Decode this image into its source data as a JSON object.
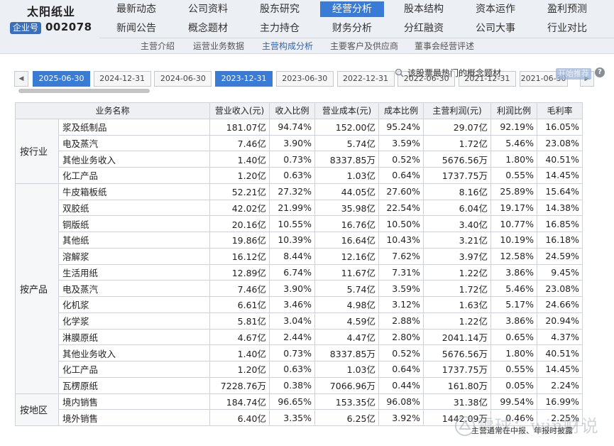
{
  "company": {
    "name": "太阳纸业",
    "code_label": "企业号",
    "code": "002078"
  },
  "nav": {
    "row1": [
      "最新动态",
      "公司资料",
      "股东研究",
      "经营分析",
      "股本结构",
      "资本运作",
      "盈利预测"
    ],
    "row2": [
      "新闻公告",
      "概念题材",
      "主力持仓",
      "财务分析",
      "分红融资",
      "公司大事",
      "行业对比"
    ],
    "active": "经营分析"
  },
  "subnav": {
    "items": [
      "主营介绍",
      "运营业务数据",
      "主营构成分析",
      "主要客户及供应商",
      "董事会经营评述"
    ],
    "active": "主营构成分析"
  },
  "periods": {
    "dates": [
      "2025-06-30",
      "2024-12-31",
      "2024-06-30",
      "2023-12-31",
      "2023-06-30",
      "2022-12-31",
      "2022-06-30",
      "2021-12-31",
      "2021-06-30"
    ],
    "active_indices": [
      0,
      3
    ],
    "prev_arrow": "◀",
    "next_arrow": "▶"
  },
  "concept": {
    "link_text": "该股票最热门的概念题材",
    "faded_button": "开始推荐",
    "help": "?"
  },
  "table": {
    "headers": [
      "业务名称",
      "营业收入(元)",
      "收入比例",
      "营业成本(元)",
      "成本比例",
      "主营利润(元)",
      "利润比例",
      "毛利率"
    ],
    "groups": [
      {
        "category": "按行业",
        "rows": [
          [
            "浆及纸制品",
            "181.07亿",
            "94.74%",
            "152.00亿",
            "95.24%",
            "29.07亿",
            "92.19%",
            "16.05%"
          ],
          [
            "电及蒸汽",
            "7.46亿",
            "3.90%",
            "5.74亿",
            "3.59%",
            "1.72亿",
            "5.46%",
            "23.08%"
          ],
          [
            "其他业务收入",
            "1.40亿",
            "0.73%",
            "8337.85万",
            "0.52%",
            "5676.56万",
            "1.80%",
            "40.51%"
          ],
          [
            "化工产品",
            "1.20亿",
            "0.63%",
            "1.03亿",
            "0.64%",
            "1737.75万",
            "0.55%",
            "14.45%"
          ]
        ]
      },
      {
        "category": "按产品",
        "rows": [
          [
            "牛皮箱板纸",
            "52.21亿",
            "27.32%",
            "44.05亿",
            "27.60%",
            "8.16亿",
            "25.89%",
            "15.64%"
          ],
          [
            "双胶纸",
            "42.02亿",
            "21.99%",
            "35.98亿",
            "22.54%",
            "6.04亿",
            "19.17%",
            "14.38%"
          ],
          [
            "铜版纸",
            "20.16亿",
            "10.55%",
            "16.76亿",
            "10.50%",
            "3.40亿",
            "10.77%",
            "16.85%"
          ],
          [
            "其他纸",
            "19.86亿",
            "10.39%",
            "16.64亿",
            "10.43%",
            "3.21亿",
            "10.19%",
            "16.18%"
          ],
          [
            "溶解浆",
            "16.12亿",
            "8.44%",
            "12.16亿",
            "7.62%",
            "3.97亿",
            "12.58%",
            "24.59%"
          ],
          [
            "生活用纸",
            "12.89亿",
            "6.74%",
            "11.67亿",
            "7.31%",
            "1.22亿",
            "3.86%",
            "9.45%"
          ],
          [
            "电及蒸汽",
            "7.46亿",
            "3.90%",
            "5.74亿",
            "3.59%",
            "1.72亿",
            "5.46%",
            "23.08%"
          ],
          [
            "化机浆",
            "6.61亿",
            "3.46%",
            "4.98亿",
            "3.12%",
            "1.63亿",
            "5.17%",
            "24.66%"
          ],
          [
            "化学浆",
            "5.81亿",
            "3.04%",
            "4.59亿",
            "2.88%",
            "1.22亿",
            "3.86%",
            "20.94%"
          ],
          [
            "淋膜原纸",
            "4.67亿",
            "2.44%",
            "4.47亿",
            "2.80%",
            "2041.14万",
            "0.65%",
            "4.37%"
          ],
          [
            "其他业务收入",
            "1.40亿",
            "0.73%",
            "8337.85万",
            "0.52%",
            "5676.56万",
            "1.80%",
            "40.51%"
          ],
          [
            "化工产品",
            "1.20亿",
            "0.63%",
            "1.03亿",
            "0.64%",
            "1737.75万",
            "0.55%",
            "14.45%"
          ],
          [
            "瓦楞原纸",
            "7228.76万",
            "0.38%",
            "7066.96万",
            "0.44%",
            "161.80万",
            "0.05%",
            "2.24%"
          ]
        ]
      },
      {
        "category": "按地区",
        "rows": [
          [
            "境内销售",
            "184.74亿",
            "96.65%",
            "153.35亿",
            "96.08%",
            "31.38亿",
            "99.54%",
            "16.99%"
          ],
          [
            "境外销售",
            "6.40亿",
            "3.35%",
            "6.25亿",
            "3.92%",
            "1442.09万",
            "0.46%",
            "2.25%"
          ]
        ]
      }
    ]
  },
  "footer": {
    "note": "主营通常在中报、年报时披露",
    "watermark": "雪球：win财说"
  }
}
